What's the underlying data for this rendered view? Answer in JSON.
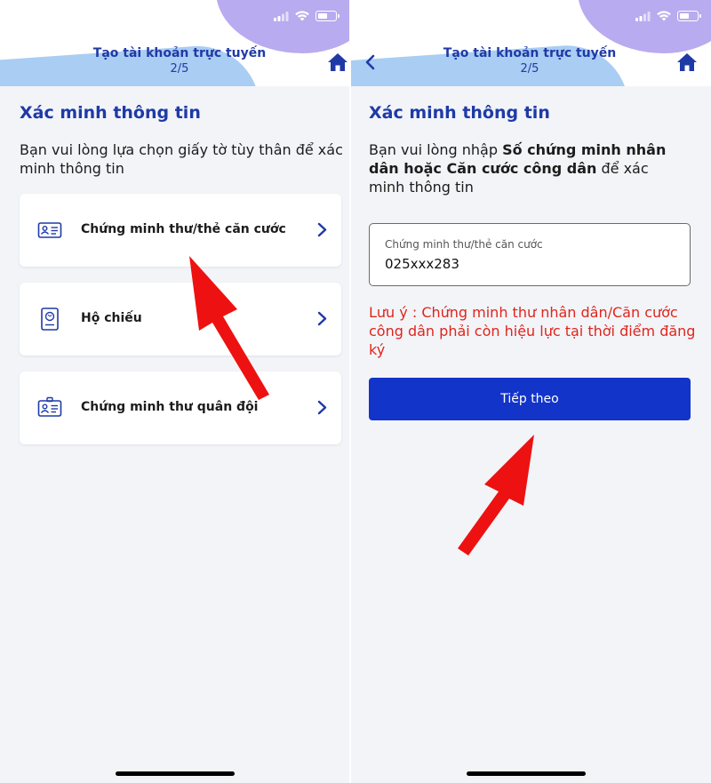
{
  "header": {
    "title": "Tạo tài khoản trực tuyến",
    "step": "2/5"
  },
  "left": {
    "heading": "Xác minh thông tin",
    "description": "Bạn vui lòng lựa chọn giấy tờ tùy thân để xác minh thông tin",
    "options": [
      {
        "label": "Chứng minh thư/thẻ căn cước",
        "icon": "id-card-icon"
      },
      {
        "label": "Hộ chiếu",
        "icon": "passport-icon"
      },
      {
        "label": "Chứng minh thư quân đội",
        "icon": "military-id-icon"
      }
    ]
  },
  "right": {
    "heading": "Xác minh thông tin",
    "description_prefix": "Bạn vui lòng nhập ",
    "description_bold": "Số chứng minh nhân dân hoặc Căn cước công dân",
    "description_suffix": " để xác minh thông tin",
    "field_label": "Chứng minh thư/thẻ căn cước",
    "field_value": "025xxx283",
    "warning": "Lưu ý : Chứng minh thư nhân dân/Căn cước công dân phải còn hiệu lực tại thời điểm đăng ký",
    "next_label": "Tiếp theo"
  },
  "colors": {
    "brand_blue": "#1f3aa6",
    "button_blue": "#1334c9",
    "warning_red": "#e0251c",
    "arrow_red": "#ee1111",
    "header_blob_blue": "#a9cdf3",
    "header_blob_purple": "#b9abef"
  }
}
